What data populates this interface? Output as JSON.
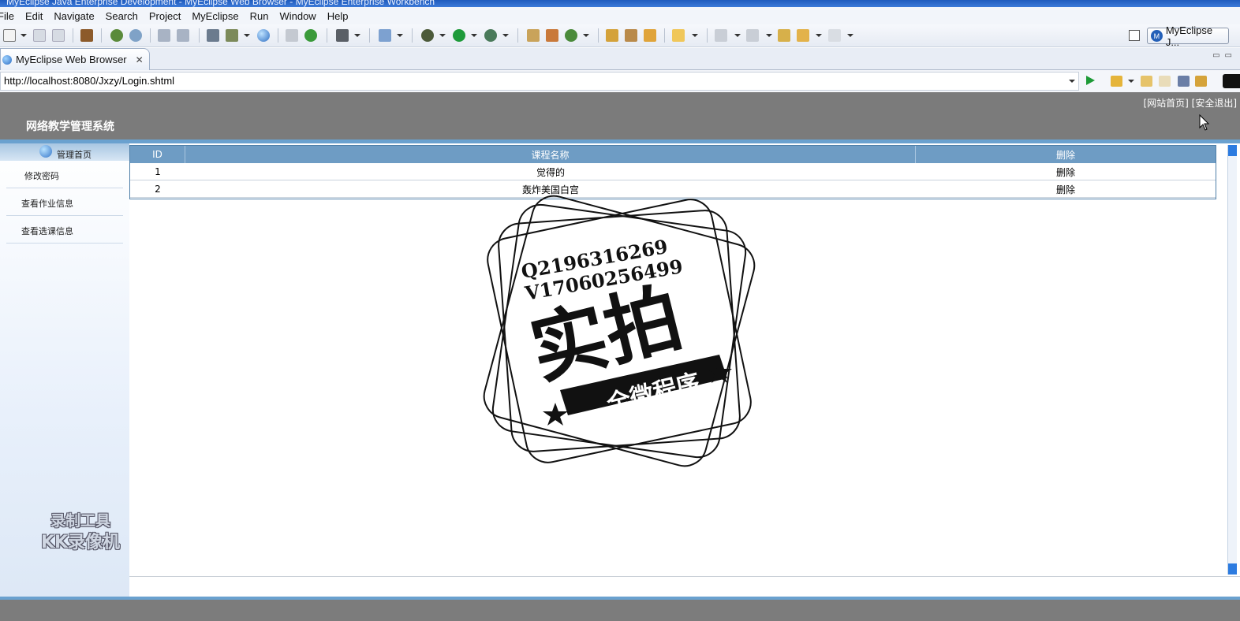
{
  "window": {
    "title": "MyEclipse Java Enterprise Development - MyEclipse Web Browser - MyEclipse Enterprise Workbench"
  },
  "menu": [
    "File",
    "Edit",
    "Navigate",
    "Search",
    "Project",
    "MyEclipse",
    "Run",
    "Window",
    "Help"
  ],
  "toolbar": {
    "perspective_label": "MyEclipse J...",
    "perspective_logo": "M"
  },
  "editor_tab": {
    "label": "MyEclipse Web Browser",
    "close": "✕"
  },
  "address": {
    "url": "http://localhost:8080/Jxzy/Login.shtml"
  },
  "page": {
    "header_links": "[网站首页] [安全退出]",
    "site_title": "网络教学管理系统",
    "sidebar": {
      "home": "管理首页",
      "items": [
        "修改密码",
        "查看作业信息",
        "查看选课信息"
      ]
    },
    "table": {
      "columns": [
        "ID",
        "课程名称",
        "删除"
      ],
      "rows": [
        {
          "id": "1",
          "name": "觉得的",
          "action": "删除"
        },
        {
          "id": "2",
          "name": "轰炸美国白宫",
          "action": "删除"
        }
      ]
    }
  },
  "watermark": {
    "stamp_line1": "Q2196316269",
    "stamp_line2": "V17060256499",
    "stamp_big": "实拍",
    "stamp_banner": "全微程序",
    "recorder_line1": "录制工具",
    "recorder_line2": "KK录像机"
  }
}
